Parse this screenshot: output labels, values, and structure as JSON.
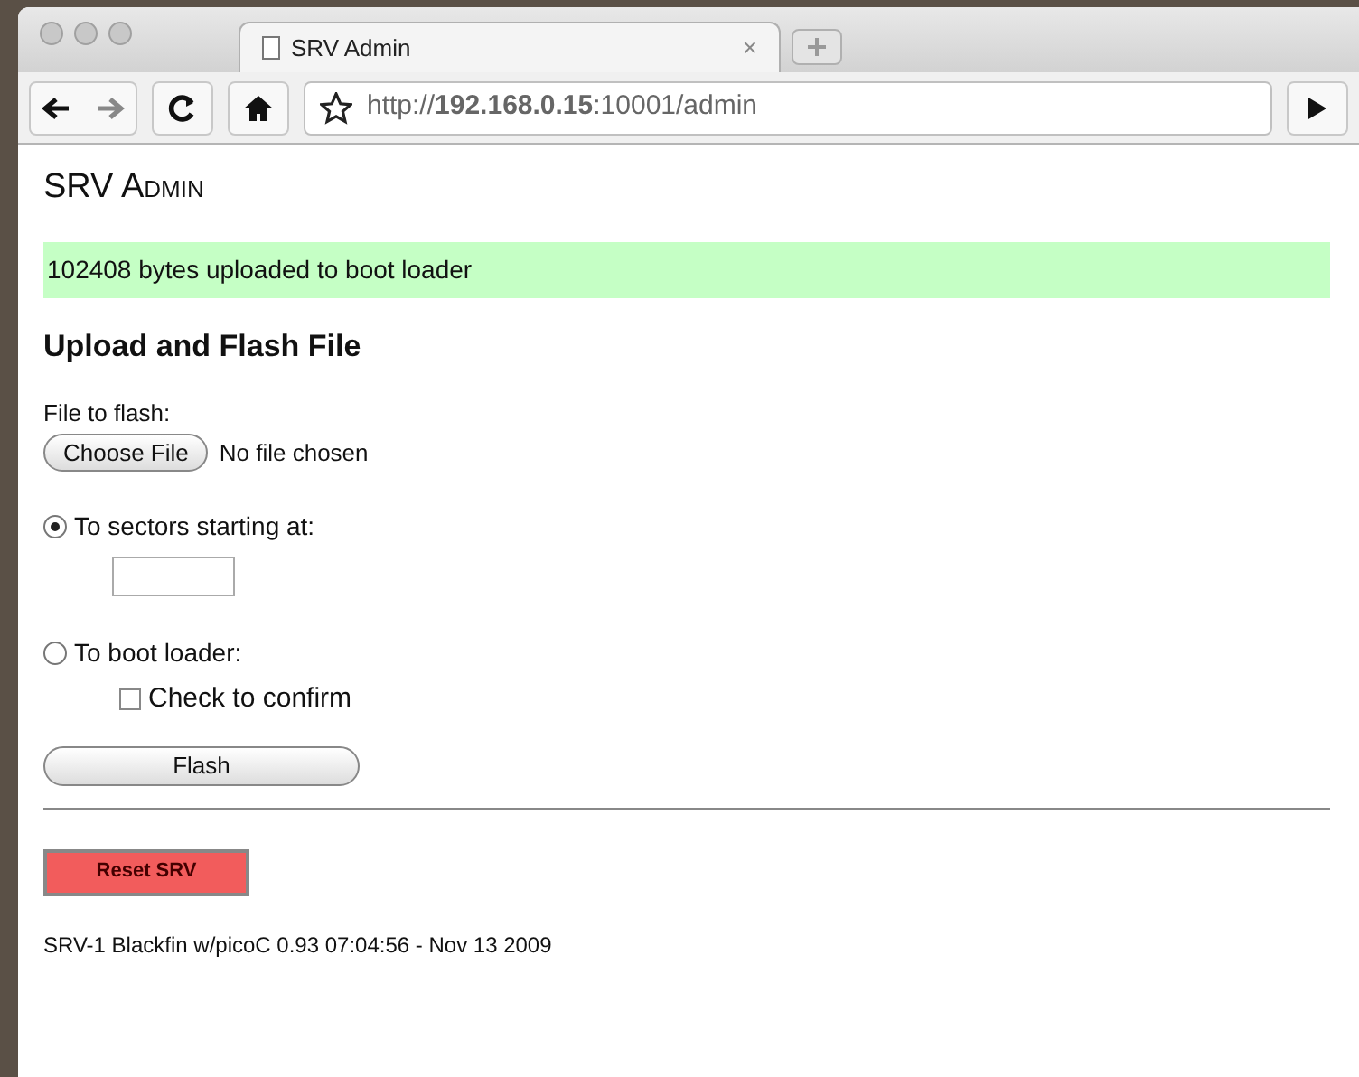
{
  "browser": {
    "tab_title": "SRV Admin",
    "tab_close": "×",
    "url": "http://**192.168.0.15**:10001/admin"
  },
  "page": {
    "title": "SRV Admin",
    "status": "102408 bytes uploaded to boot loader",
    "heading": "Upload and Flash File",
    "file_label": "File to flash:",
    "choose_button": "Choose File",
    "file_status": "No file chosen",
    "options": [
      {
        "label": "To sectors starting at:",
        "selected": true,
        "kind": "address"
      },
      {
        "label": "To boot loader:",
        "selected": false,
        "kind": "confirm",
        "confirm_label": "Check to confirm",
        "checked": false
      }
    ],
    "flash_button": "Flash",
    "reset_button": "Reset SRV",
    "footer": "SRV-1 Blackfin w/picoC 0.93 07:04:56 - Nov 13 2009"
  }
}
